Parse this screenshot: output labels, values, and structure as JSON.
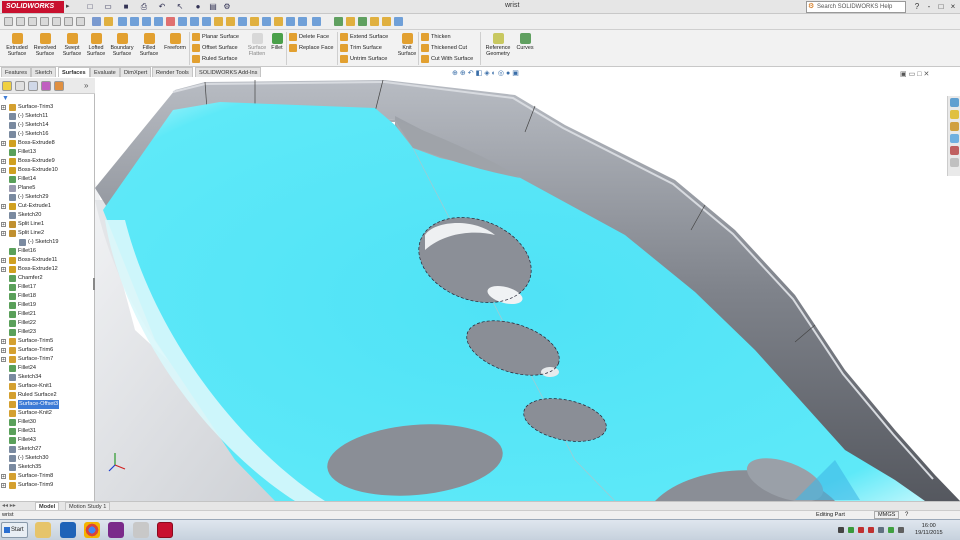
{
  "titlebar": {
    "app_name": "SOLIDWORKS",
    "window_title": "wrist",
    "help_search_placeholder": "Search SOLIDWORKS Help",
    "controls": [
      "?",
      "-",
      "□",
      "×"
    ]
  },
  "ribbon": {
    "large_buttons": [
      "Extruded Surface",
      "Revolved Surface",
      "Swept Surface",
      "Lofted Surface",
      "Boundary Surface",
      "Filled Surface",
      "Freeform"
    ],
    "group1": [
      "Planar Surface",
      "Offset Surface",
      "Ruled Surface"
    ],
    "surface_flatten": "Surface Flatten",
    "fillet": "Fillet",
    "group2": [
      "Delete Face",
      "Replace Face"
    ],
    "group3": [
      "Extend Surface",
      "Trim Surface",
      "Untrim Surface"
    ],
    "knit_surface": "Knit Surface",
    "group4": [
      "Thicken",
      "Thickened Cut",
      "Cut With Surface"
    ],
    "reference_geometry": "Reference Geometry",
    "curves": "Curves"
  },
  "command_tabs": [
    "Features",
    "Sketch",
    "Surfaces",
    "Evaluate",
    "DimXpert",
    "Render Tools",
    "SOLIDWORKS Add-Ins"
  ],
  "active_tab": "Surfaces",
  "feature_tree": [
    {
      "label": "Surface-Trim3",
      "type": "surface",
      "expand": true,
      "indent": 0
    },
    {
      "label": "(-) Sketch11",
      "type": "sketch",
      "expand": false,
      "indent": 0
    },
    {
      "label": "(-) Sketch14",
      "type": "sketch",
      "expand": false,
      "indent": 0
    },
    {
      "label": "(-) Sketch16",
      "type": "sketch",
      "expand": false,
      "indent": 0
    },
    {
      "label": "Boss-Extrude8",
      "type": "feature",
      "expand": true,
      "indent": 0
    },
    {
      "label": "Fillet13",
      "type": "fillet",
      "expand": false,
      "indent": 0
    },
    {
      "label": "Boss-Extrude9",
      "type": "feature",
      "expand": true,
      "indent": 0
    },
    {
      "label": "Boss-Extrude10",
      "type": "feature",
      "expand": true,
      "indent": 0
    },
    {
      "label": "Fillet14",
      "type": "fillet",
      "expand": false,
      "indent": 0
    },
    {
      "label": "Plane5",
      "type": "plane",
      "expand": false,
      "indent": 0
    },
    {
      "label": "(-) Sketch29",
      "type": "sketch",
      "expand": false,
      "indent": 0
    },
    {
      "label": "Cut-Extrude1",
      "type": "feature",
      "expand": true,
      "indent": 0
    },
    {
      "label": "Sketch20",
      "type": "sketch",
      "expand": false,
      "indent": 0
    },
    {
      "label": "Split Line1",
      "type": "split",
      "expand": true,
      "indent": 0
    },
    {
      "label": "Split Line2",
      "type": "split",
      "expand": true,
      "indent": 0
    },
    {
      "label": "(-) Sketch19",
      "type": "sketch",
      "expand": false,
      "indent": 1
    },
    {
      "label": "Fillet16",
      "type": "fillet",
      "expand": false,
      "indent": 0
    },
    {
      "label": "Boss-Extrude11",
      "type": "feature",
      "expand": true,
      "indent": 0
    },
    {
      "label": "Boss-Extrude12",
      "type": "feature",
      "expand": true,
      "indent": 0
    },
    {
      "label": "Chamfer2",
      "type": "fillet",
      "expand": false,
      "indent": 0
    },
    {
      "label": "Fillet17",
      "type": "fillet",
      "expand": false,
      "indent": 0
    },
    {
      "label": "Fillet18",
      "type": "fillet",
      "expand": false,
      "indent": 0
    },
    {
      "label": "Fillet19",
      "type": "fillet",
      "expand": false,
      "indent": 0
    },
    {
      "label": "Fillet21",
      "type": "fillet",
      "expand": false,
      "indent": 0
    },
    {
      "label": "Fillet22",
      "type": "fillet",
      "expand": false,
      "indent": 0
    },
    {
      "label": "Fillet23",
      "type": "fillet",
      "expand": false,
      "indent": 0
    },
    {
      "label": "Surface-Trim5",
      "type": "surface",
      "expand": true,
      "indent": 0
    },
    {
      "label": "Surface-Trim6",
      "type": "surface",
      "expand": true,
      "indent": 0
    },
    {
      "label": "Surface-Trim7",
      "type": "surface",
      "expand": true,
      "indent": 0
    },
    {
      "label": "Fillet24",
      "type": "fillet",
      "expand": false,
      "indent": 0
    },
    {
      "label": "Sketch34",
      "type": "sketch",
      "expand": false,
      "indent": 0
    },
    {
      "label": "Surface-Knit1",
      "type": "surface",
      "expand": false,
      "indent": 0
    },
    {
      "label": "Ruled Surface2",
      "type": "surface",
      "expand": false,
      "indent": 0
    },
    {
      "label": "Surface-Offset3",
      "type": "surface",
      "expand": false,
      "indent": 0,
      "selected": true
    },
    {
      "label": "Surface-Knit2",
      "type": "surface",
      "expand": false,
      "indent": 0
    },
    {
      "label": "Fillet30",
      "type": "fillet",
      "expand": false,
      "indent": 0
    },
    {
      "label": "Fillet31",
      "type": "fillet",
      "expand": false,
      "indent": 0
    },
    {
      "label": "Fillet43",
      "type": "fillet",
      "expand": false,
      "indent": 0
    },
    {
      "label": "Sketch27",
      "type": "sketch",
      "expand": false,
      "indent": 0
    },
    {
      "label": "(-) Sketch30",
      "type": "sketch",
      "expand": false,
      "indent": 0
    },
    {
      "label": "Sketch35",
      "type": "sketch",
      "expand": false,
      "indent": 0
    },
    {
      "label": "Surface-Trim8",
      "type": "surface",
      "expand": true,
      "indent": 0
    },
    {
      "label": "Surface-Trim9",
      "type": "surface",
      "expand": true,
      "indent": 0
    }
  ],
  "bottom_tabs": [
    "Model",
    "Motion Study 1"
  ],
  "active_bottom_tab": "Model",
  "status": {
    "doc_name": "wrist",
    "mode": "Editing Part",
    "units": "MMGS"
  },
  "taskbar": {
    "start_label": "Start",
    "time": "16:00",
    "date": "19/11/2015"
  },
  "colors": {
    "brand": "#c8102e",
    "surface_cyan": "#5ee8f7",
    "part_gray": "#8c8f96",
    "selection": "#3d7bd6"
  }
}
